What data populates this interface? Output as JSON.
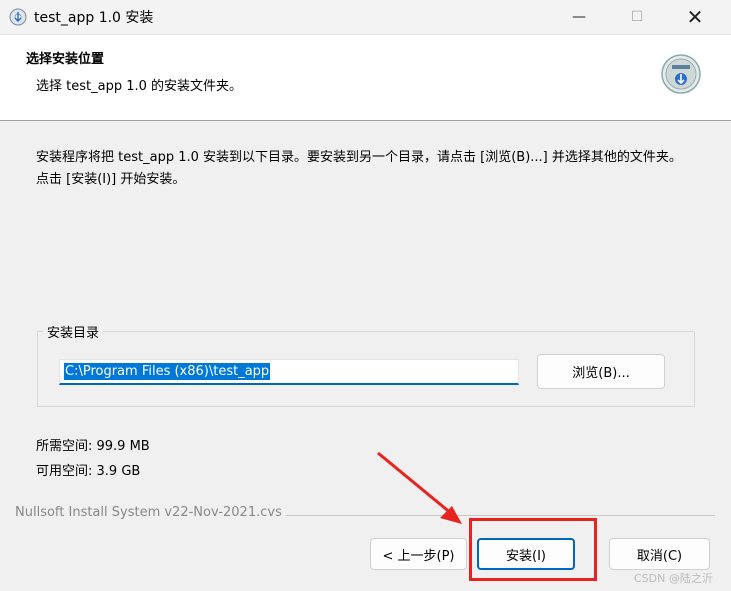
{
  "window": {
    "title": "test_app 1.0 安装",
    "minimize_label": "—",
    "maximize_label": "☐",
    "close_label": "✕"
  },
  "header": {
    "title": "选择安装位置",
    "subtitle": "选择 test_app 1.0 的安装文件夹。"
  },
  "instructions": "安装程序将把 test_app 1.0 安装到以下目录。要安装到另一个目录，请点击 [浏览(B)...] 并选择其他的文件夹。 点击 [安装(I)] 开始安装。",
  "install_dir": {
    "group_label": "安装目录",
    "path_value": "C:\\Program Files (x86)\\test_app",
    "browse_label": "浏览(B)..."
  },
  "space": {
    "required": "所需空间: 99.9 MB",
    "available": "可用空间: 3.9 GB"
  },
  "branding": "Nullsoft Install System v22-Nov-2021.cvs",
  "buttons": {
    "back": "< 上一步(P)",
    "install": "安装(I)",
    "cancel": "取消(C)"
  },
  "watermark": "CSDN @陆之沂",
  "colors": {
    "accent": "#0067c0",
    "selection": "#0078d7",
    "annotation_red": "#e8231f"
  },
  "icons": {
    "app": "installer-cd-icon",
    "header": "installer-disk-icon"
  }
}
